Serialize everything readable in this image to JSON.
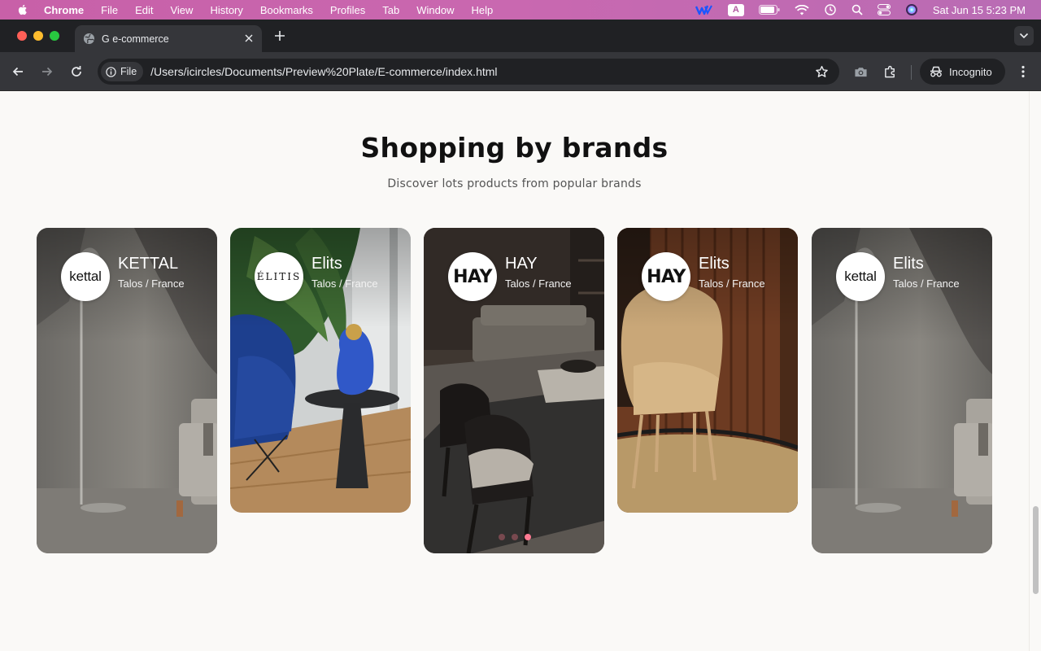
{
  "menubar": {
    "app_name": "Chrome",
    "items": [
      "File",
      "Edit",
      "View",
      "History",
      "Bookmarks",
      "Profiles",
      "Tab",
      "Window",
      "Help"
    ],
    "keyboard_indicator": "A",
    "clock": "Sat Jun 15  5:23 PM"
  },
  "tab": {
    "title": "G e-commerce"
  },
  "toolbar": {
    "chip_label": "File",
    "url": "/Users/icircles/Documents/Preview%20Plate/E-commerce/index.html",
    "incognito_label": "Incognito"
  },
  "page": {
    "section_title": "Shopping by brands",
    "section_subtitle": "Discover lots products from popular brands",
    "brands": [
      {
        "logo_text": "kettal",
        "name": "KETTAL",
        "location": "Talos / France",
        "scene": "lamp-sofa"
      },
      {
        "logo_text": "ÉLITIS",
        "name": "Elits",
        "location": "Talos / France",
        "scene": "blue-chair-gorilla"
      },
      {
        "logo_text": "HAY",
        "name": "HAY",
        "location": "Talos / France",
        "scene": "dark-living-room"
      },
      {
        "logo_text": "HAY",
        "name": "Elits",
        "location": "Talos / France",
        "scene": "tan-chair-wood-wall"
      },
      {
        "logo_text": "kettal",
        "name": "Elits",
        "location": "Talos / France",
        "scene": "lamp-sofa"
      }
    ],
    "carousel": {
      "slides": 3,
      "active_index": 2
    }
  },
  "colors": {
    "page_background": "#faf9f7",
    "carousel_active_dot": "#ff7a92",
    "menubar_gradient": "#c860a8"
  }
}
